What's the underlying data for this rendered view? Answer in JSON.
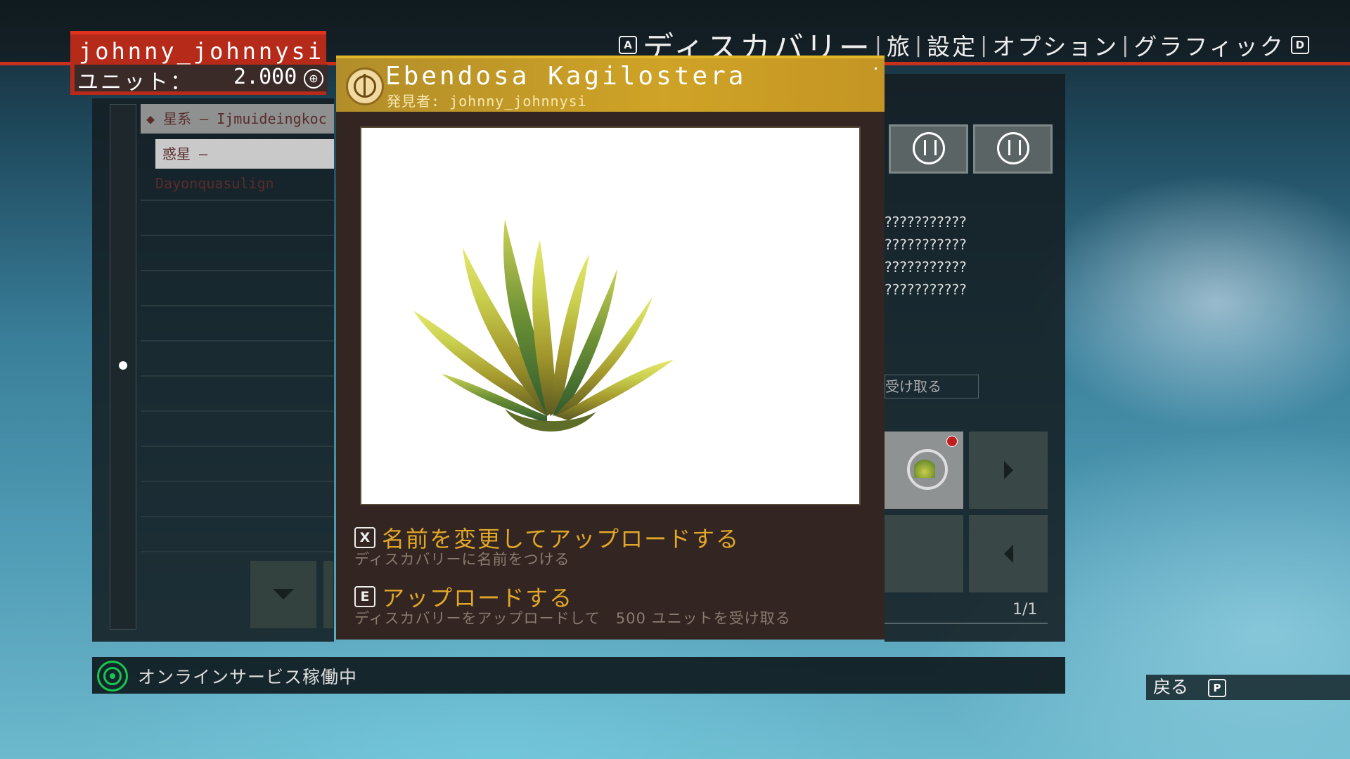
{
  "nav": {
    "left_key": "A",
    "items": [
      "ディスカバリー",
      "旅",
      "設定",
      "オプション",
      "グラフィック"
    ],
    "right_key": "D"
  },
  "user": {
    "name": "johnny_johnnysi",
    "units_label": "ユニット：",
    "units_value": "2.000",
    "units_icon": "currency-icon"
  },
  "list": {
    "galaxy_row": "◆ 星系 – Ijmuideingkoc",
    "planet_row": "惑星 – Dayonquasulign"
  },
  "right_panel": {
    "unknown_lines": [
      "???????????",
      "???????????",
      "???????????",
      "???????????"
    ],
    "receive_label": "受け取る",
    "pager": "1/1"
  },
  "dialog": {
    "title": "Ebendosa Kagilostera",
    "subtitle": "発見者: johnny_johnnysi",
    "actions": [
      {
        "key": "X",
        "label": "名前を変更してアップロードする",
        "desc": "ディスカバリーに名前をつける"
      },
      {
        "key": "E",
        "label": "アップロードする",
        "desc": "ディスカバリーをアップロードして　500 ユニットを受け取る"
      }
    ]
  },
  "status": {
    "text": "オンラインサービス稼働中"
  },
  "back": {
    "label": "戻る",
    "key": "P"
  },
  "colors": {
    "accent_gold": "#cfa326",
    "accent_red": "#c8301d",
    "online_green": "#17c653"
  }
}
